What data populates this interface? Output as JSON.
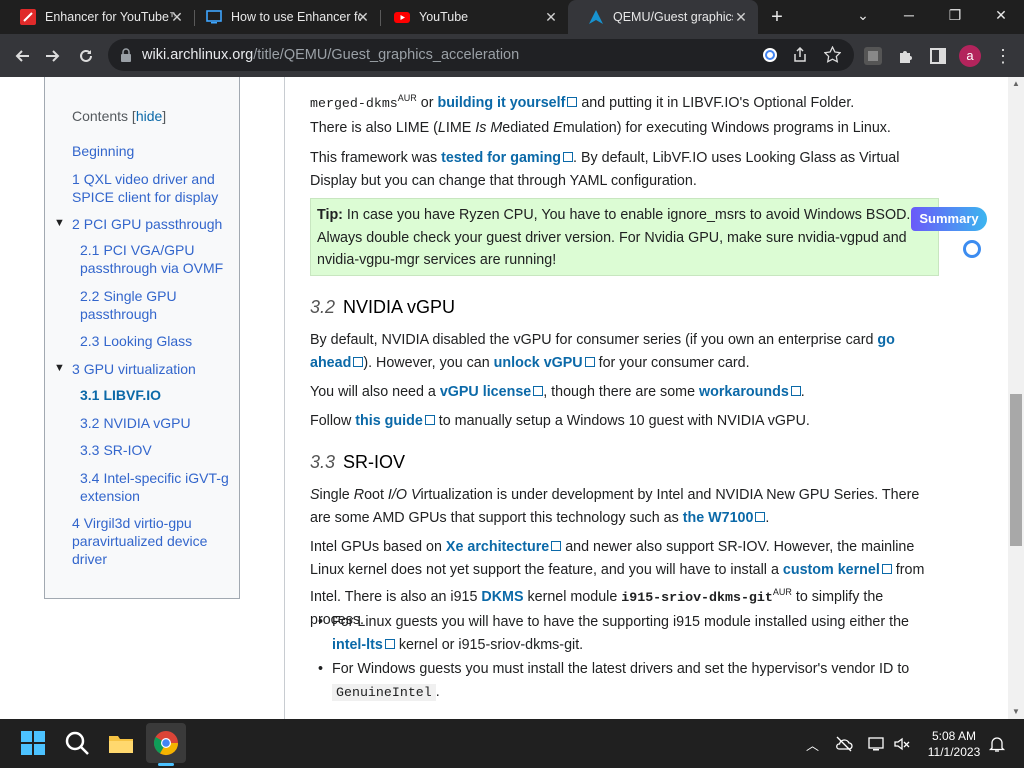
{
  "browser": {
    "tabs": [
      {
        "title": "Enhancer for YouTube™",
        "icon": "enhancer-icon"
      },
      {
        "title": "How to use Enhancer fo",
        "icon": "monitor-icon"
      },
      {
        "title": "YouTube",
        "icon": "youtube-icon"
      },
      {
        "title": "QEMU/Guest graphics",
        "icon": "arch-icon"
      }
    ],
    "new_tab_label": "+",
    "address": {
      "host": "wiki.archlinux.org",
      "path": "/title/QEMU/Guest_graphics_acceleration"
    },
    "profile_initial": "a"
  },
  "toc": {
    "title": "Contents",
    "hide_label": "hide",
    "items": [
      {
        "num": "",
        "label": "Beginning"
      },
      {
        "num": "1",
        "label": "QXL video driver and SPICE client for display"
      },
      {
        "num": "2",
        "label": "PCI GPU passthrough"
      },
      {
        "num": "2.1",
        "label": "PCI VGA/GPU passthrough via OVMF"
      },
      {
        "num": "2.2",
        "label": "Single GPU passthrough"
      },
      {
        "num": "2.3",
        "label": "Looking Glass"
      },
      {
        "num": "3",
        "label": "GPU virtualization"
      },
      {
        "num": "3.1",
        "label": "LIBVF.IO"
      },
      {
        "num": "3.2",
        "label": "NVIDIA vGPU"
      },
      {
        "num": "3.3",
        "label": "SR-IOV"
      },
      {
        "num": "3.4",
        "label": "Intel-specific iGVT-g extension"
      },
      {
        "num": "4",
        "label": "Virgil3d virtio-gpu paravirtualized device driver"
      }
    ]
  },
  "article": {
    "p0": {
      "code": "merged-dkms",
      "sup": "AUR",
      "t1": " or ",
      "link": "building it yourself",
      "t2": " and putting it in LIBVF.IO's Optional Folder."
    },
    "p1": {
      "t1": "There is also LIME (",
      "i1": "L",
      "t2": "IME ",
      "i2": "Is M",
      "t3": "ediated ",
      "i3": "E",
      "t4": "mulation) for executing Windows programs in Linux."
    },
    "p2": {
      "t1": "This framework was ",
      "link": "tested for gaming",
      "t2": ". By default, LibVF.IO uses Looking Glass as Virtual Display but you can change that through YAML configuration."
    },
    "tip": {
      "label": "Tip:",
      "text": " In case you have Ryzen CPU, You have to enable ignore_msrs to avoid Windows BSOD. Always double check your guest driver version. For Nvidia GPU, make sure nvidia-vgpud and nvidia-vgpu-mgr services are running!"
    },
    "h_nvidia": {
      "num": "3.2",
      "title": "NVIDIA vGPU"
    },
    "p3": {
      "t1": "By default, NVIDIA disabled the vGPU for consumer series (if you own an enterprise card ",
      "link1": "go ahead",
      "t2": "). However, you can ",
      "link2": "unlock vGPU",
      "t3": " for your consumer card."
    },
    "p4": {
      "t1": "You will also need a ",
      "link1": "vGPU license",
      "t2": ", though there are some ",
      "link2": "workarounds",
      "t3": "."
    },
    "p5": {
      "t1": "Follow ",
      "link": "this guide",
      "t2": " to manually setup a Windows 10 guest with NVIDIA vGPU."
    },
    "h_sriov": {
      "num": "3.3",
      "title": "SR-IOV"
    },
    "p6": {
      "i1": "S",
      "t1": "ingle ",
      "i2": "R",
      "t2": "oot ",
      "i3": "I/O V",
      "t3": "irtualization is under development by Intel and NVIDIA New GPU Series. There are some AMD GPUs that support this technology such as ",
      "link": "the W7100",
      "t4": "."
    },
    "p7": {
      "t1": "Intel GPUs based on ",
      "link1": "Xe architecture",
      "t2": " and newer also support SR-IOV. However, the mainline Linux kernel does not yet support the feature, and you will have to install a ",
      "link2": "custom kernel",
      "t3": " from Intel. There is also an i915 ",
      "link3": "DKMS",
      "t4": " kernel module ",
      "code": "i915-sriov-dkms-git",
      "sup": "AUR",
      "t5": " to simplify the process."
    },
    "li1": {
      "t1": "For Linux guests you will have to have the supporting i915 module installed using either the ",
      "link": "intel-lts",
      "t2": " kernel or i915-sriov-dkms-git."
    },
    "li2": {
      "t1": "For Windows guests you must install the latest drivers and set the hypervisor's vendor ID to ",
      "code": "GenuineIntel",
      "t2": "."
    }
  },
  "summary_button": "Summary",
  "taskbar": {
    "time": "5:08 AM",
    "date": "11/1/2023"
  },
  "colors": {
    "link": "#0b69a8",
    "tip_bg": "#dcfcd4",
    "tab_bar": "#1f1f1f",
    "toolbar": "#35363a"
  }
}
